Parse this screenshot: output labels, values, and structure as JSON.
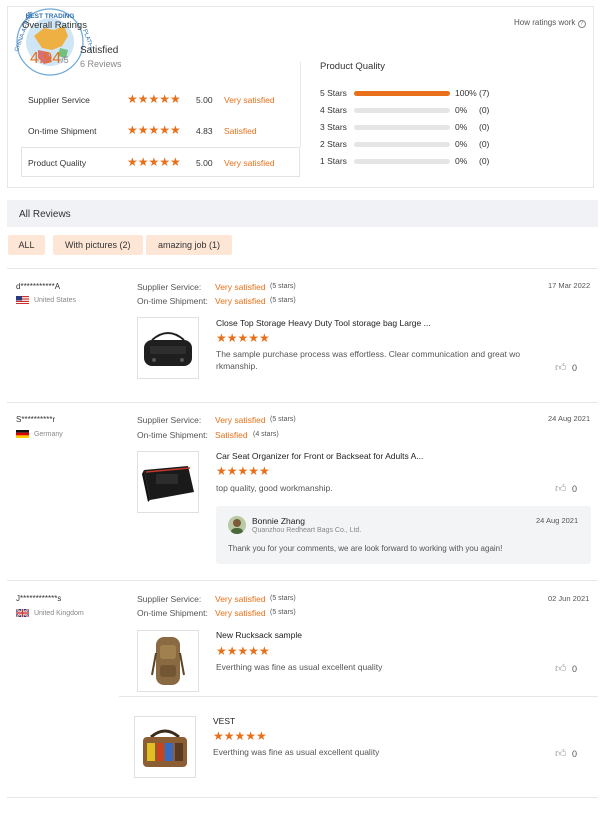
{
  "logo": {
    "text": "CHINA-AFRICA BEST TRADING PLATFORM"
  },
  "summary": {
    "overall_label": "Overall Ratings",
    "score": "4.94",
    "score_suffix": "/5",
    "satisfied": "Satisfied",
    "reviews": "6 Reviews",
    "how_link": "How ratings work",
    "rows": [
      {
        "label": "Supplier Service",
        "score": "5.00",
        "status": "Very satisfied"
      },
      {
        "label": "On-time Shipment",
        "score": "4.83",
        "status": "Satisfied"
      },
      {
        "label": "Product Quality",
        "score": "5.00",
        "status": "Very satisfied"
      }
    ]
  },
  "product_quality": {
    "title": "Product Quality",
    "rows": [
      {
        "label": "5 Stars",
        "pct": "100%",
        "count": "(7)",
        "fraction": 1.0
      },
      {
        "label": "4 Stars",
        "pct": "0%",
        "count": "(0)",
        "fraction": 0
      },
      {
        "label": "3 Stars",
        "pct": "0%",
        "count": "(0)",
        "fraction": 0
      },
      {
        "label": "2 Stars",
        "pct": "0%",
        "count": "(0)",
        "fraction": 0
      },
      {
        "label": "1 Stars",
        "pct": "0%",
        "count": "(0)",
        "fraction": 0
      }
    ]
  },
  "all_reviews": {
    "title": "All Reviews",
    "filters": [
      "ALL",
      "With pictures (2)",
      "amazing job (1)"
    ]
  },
  "labels": {
    "supplier_service": "Supplier Service:",
    "ontime": "On-time Shipment:"
  },
  "reviews": [
    {
      "user": "d***********A",
      "country": "United States",
      "date": "17 Mar 2022",
      "service": "Very satisfied",
      "service_stars": "(5 stars)",
      "shipment": "Very satisfied",
      "shipment_stars": "(5 stars)",
      "product": "Close Top Storage Heavy Duty Tool storage bag Large ...",
      "text1": "The sample purchase process was effortless. Clear communication and great wo",
      "text2": "rkmanship.",
      "likes": "0"
    },
    {
      "user": "S**********r",
      "country": "Germany",
      "date": "24 Aug 2021",
      "service": "Very satisfied",
      "service_stars": "(5 stars)",
      "shipment": "Satisfied",
      "shipment_stars": "(4 stars)",
      "product": "Car Seat Organizer for Front or Backseat for Adults A...",
      "text1": "top quality, good workmanship.",
      "likes": "0",
      "reply": {
        "name": "Bonnie Zhang",
        "company": "Quanzhou Redheart Bags Co., Ltd.",
        "date": "24 Aug 2021",
        "text": "Thank you for your comments, we are look forward to working with you again!"
      }
    },
    {
      "user": "J************s",
      "country": "United Kingdom",
      "date": "02 Jun 2021",
      "service": "Very satisfied",
      "service_stars": "(5 stars)",
      "shipment": "Very satisfied",
      "shipment_stars": "(5 stars)",
      "product": "New Rucksack sample",
      "text1": "Everthing was fine as usual excellent quality",
      "likes": "0",
      "extra": {
        "product": "VEST",
        "text": "Everthing was fine as usual excellent quality",
        "likes": "0"
      }
    }
  ],
  "stars_glyph": "★★★★★"
}
